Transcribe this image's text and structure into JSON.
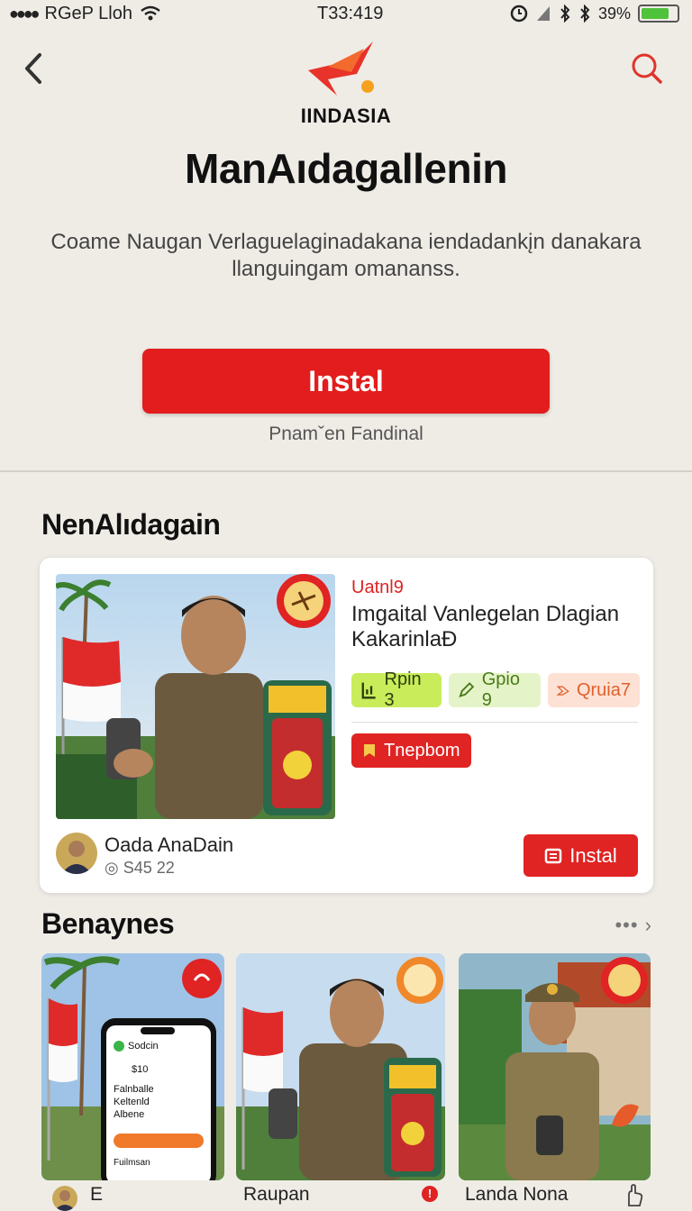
{
  "status_bar": {
    "carrier": "RGeP Lloh",
    "time": "T33:419",
    "battery_text": "39%",
    "battery_level": 0.8
  },
  "header": {
    "brand": "IINDASIA"
  },
  "app": {
    "title": "ManAıdagallenin",
    "description": "Coame Naugan Verlaguelaginadakana iendadankįn danakara llanguingam omananss.",
    "install_label": "Instal",
    "install_subtext": "Pnamˇen Fandinal"
  },
  "featured": {
    "section_title": "NenAlıdagain",
    "label": "Uatnl9",
    "title": "Imgaital Vanlegelan Dlagian KakarinlaÐ",
    "chips": [
      "Rpin 3",
      "Gpio 9",
      "Qruia7"
    ],
    "tag_label": "Tnepbom",
    "author_name": "Oada AnaDain",
    "author_stat": "S45 22",
    "install_label": "Instal"
  },
  "related": {
    "section_title": "Benaynes",
    "more_label": "•••",
    "phone_ui": {
      "search_label": "Sodcin",
      "line1": "$10",
      "line2": "Falnballe",
      "line3": "Keltenld",
      "line4": "Albene",
      "bottom_text": "Fuilmsan"
    },
    "captions": [
      "E",
      "Raupan",
      "Landa Nona"
    ]
  },
  "colors": {
    "accent": "#e31d1d",
    "background": "#efece6",
    "chip_green": "#c9ec5b",
    "chip_lime": "#e4f4c8",
    "chip_peach": "#fde1d4"
  }
}
